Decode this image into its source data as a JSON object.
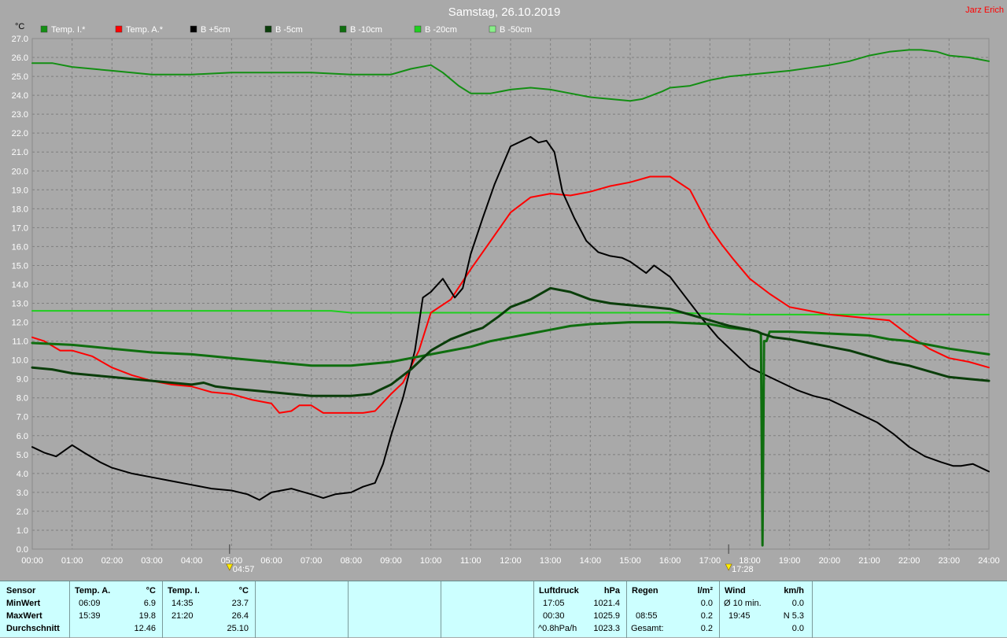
{
  "header": {
    "title": "Samstag, 26.10.2019",
    "author": "Jarz Erich"
  },
  "colors": {
    "background": "#a9a9a9",
    "grid": "#7f7f7f",
    "temp_i": "#138f13",
    "temp_a": "#ff0000",
    "b_plus5": "#000000",
    "b_minus5": "#0a3d0a",
    "b_minus10": "#0f6e0f",
    "b_minus20": "#1fcf1f",
    "b_minus50": "#88ee88",
    "footer_bg": "#ccffff"
  },
  "chart_data": {
    "type": "line",
    "title": "Samstag, 26.10.2019",
    "ylabel": "°C",
    "ylim": [
      0,
      27
    ],
    "yticks": [
      "0.0",
      "1.0",
      "2.0",
      "3.0",
      "4.0",
      "5.0",
      "6.0",
      "7.0",
      "8.0",
      "9.0",
      "10.0",
      "11.0",
      "12.0",
      "13.0",
      "14.0",
      "15.0",
      "16.0",
      "17.0",
      "18.0",
      "19.0",
      "20.0",
      "21.0",
      "22.0",
      "23.0",
      "24.0",
      "25.0",
      "26.0",
      "27.0"
    ],
    "xlim": [
      0,
      24
    ],
    "xticks": [
      "00:00",
      "01:00",
      "02:00",
      "03:00",
      "04:00",
      "05:00",
      "06:00",
      "07:00",
      "08:00",
      "09:00",
      "10:00",
      "11:00",
      "12:00",
      "13:00",
      "14:00",
      "15:00",
      "16:00",
      "17:00",
      "18:00",
      "19:00",
      "20:00",
      "21:00",
      "22:00",
      "23:00",
      "24:00"
    ],
    "grid": true,
    "legend_position": "top",
    "annotations": [
      {
        "hour": 4.95,
        "label": "04:57",
        "kind": "sunrise"
      },
      {
        "hour": 17.47,
        "label": "17:28",
        "kind": "sunset"
      }
    ],
    "series": [
      {
        "name": "Temp. I.*",
        "color_key": "temp_i",
        "width": 2,
        "x": [
          0,
          0.5,
          1,
          2,
          3,
          4,
          5,
          6,
          7,
          8,
          9,
          9.5,
          10,
          10.3,
          10.7,
          11,
          11.5,
          12,
          12.5,
          13,
          13.5,
          14,
          14.5,
          15,
          15.3,
          15.8,
          16,
          16.5,
          17,
          17.5,
          18,
          19,
          20,
          20.5,
          21,
          21.5,
          22,
          22.3,
          22.7,
          23,
          23.5,
          24
        ],
        "y": [
          25.7,
          25.7,
          25.5,
          25.3,
          25.1,
          25.1,
          25.2,
          25.2,
          25.2,
          25.1,
          25.1,
          25.4,
          25.6,
          25.2,
          24.5,
          24.1,
          24.1,
          24.3,
          24.4,
          24.3,
          24.1,
          23.9,
          23.8,
          23.7,
          23.8,
          24.2,
          24.4,
          24.5,
          24.8,
          25.0,
          25.1,
          25.3,
          25.6,
          25.8,
          26.1,
          26.3,
          26.4,
          26.4,
          26.3,
          26.1,
          26.0,
          25.8
        ]
      },
      {
        "name": "Temp. A.*",
        "color_key": "temp_a",
        "width": 2,
        "x": [
          0,
          0.3,
          0.7,
          1,
          1.5,
          2,
          2.5,
          3,
          3.5,
          4,
          4.5,
          5,
          5.5,
          6,
          6.2,
          6.5,
          6.7,
          7,
          7.3,
          7.6,
          8,
          8.3,
          8.6,
          9,
          9.3,
          9.7,
          10,
          10.5,
          11,
          11.5,
          12,
          12.5,
          13,
          13.5,
          14,
          14.5,
          15,
          15.5,
          16,
          16.5,
          17,
          17.3,
          17.6,
          18,
          18.5,
          19,
          19.5,
          20,
          20.5,
          21,
          21.5,
          22,
          22.5,
          23,
          23.5,
          24
        ],
        "y": [
          11.2,
          11.0,
          10.5,
          10.5,
          10.2,
          9.6,
          9.2,
          8.9,
          8.7,
          8.6,
          8.3,
          8.2,
          7.9,
          7.7,
          7.2,
          7.3,
          7.6,
          7.6,
          7.2,
          7.2,
          7.2,
          7.2,
          7.3,
          8.2,
          8.8,
          10.5,
          12.5,
          13.2,
          14.8,
          16.3,
          17.8,
          18.6,
          18.8,
          18.7,
          18.9,
          19.2,
          19.4,
          19.7,
          19.7,
          19.0,
          17.0,
          16.1,
          15.3,
          14.3,
          13.5,
          12.8,
          12.6,
          12.4,
          12.3,
          12.2,
          12.1,
          11.3,
          10.6,
          10.1,
          9.9,
          9.6
        ]
      },
      {
        "name": "B +5cm",
        "color_key": "b_plus5",
        "width": 2,
        "x": [
          0,
          0.3,
          0.6,
          1,
          1.3,
          1.7,
          2,
          2.5,
          3,
          3.5,
          4,
          4.5,
          5,
          5.4,
          5.7,
          6,
          6.5,
          7,
          7.3,
          7.6,
          8,
          8.3,
          8.6,
          8.8,
          9,
          9.3,
          9.6,
          9.8,
          10,
          10.3,
          10.6,
          10.8,
          11,
          11.3,
          11.6,
          12,
          12.3,
          12.5,
          12.7,
          12.9,
          13.1,
          13.3,
          13.6,
          13.9,
          14.2,
          14.5,
          14.8,
          15,
          15.2,
          15.4,
          15.6,
          16,
          16.4,
          16.8,
          17.2,
          17.6,
          18,
          18.4,
          18.8,
          19.2,
          19.6,
          20,
          20.4,
          20.8,
          21.2,
          21.6,
          22,
          22.4,
          22.8,
          23.1,
          23.3,
          23.6,
          24
        ],
        "y": [
          5.4,
          5.1,
          4.9,
          5.5,
          5.1,
          4.6,
          4.3,
          4.0,
          3.8,
          3.6,
          3.4,
          3.2,
          3.1,
          2.9,
          2.6,
          3.0,
          3.2,
          2.9,
          2.7,
          2.9,
          3.0,
          3.3,
          3.5,
          4.5,
          6.0,
          8.0,
          10.5,
          13.3,
          13.6,
          14.3,
          13.3,
          13.8,
          15.6,
          17.5,
          19.3,
          21.3,
          21.6,
          21.8,
          21.5,
          21.6,
          21.0,
          18.9,
          17.5,
          16.3,
          15.7,
          15.5,
          15.4,
          15.2,
          14.9,
          14.6,
          15.0,
          14.4,
          13.3,
          12.2,
          11.2,
          10.4,
          9.6,
          9.2,
          8.8,
          8.4,
          8.1,
          7.9,
          7.5,
          7.1,
          6.7,
          6.1,
          5.4,
          4.9,
          4.6,
          4.4,
          4.4,
          4.5,
          4.1
        ]
      },
      {
        "name": "B -5cm",
        "color_key": "b_minus5",
        "width": 3,
        "x": [
          0,
          0.5,
          1,
          1.5,
          2,
          2.5,
          3,
          3.5,
          4,
          4.3,
          4.6,
          5,
          5.5,
          6,
          6.5,
          7,
          7.5,
          8,
          8.5,
          9,
          9.5,
          10,
          10.5,
          11,
          11.3,
          11.7,
          12,
          12.5,
          13,
          13.5,
          14,
          14.5,
          15,
          15.5,
          16,
          16.5,
          17,
          17.5,
          18,
          18.2,
          18.3,
          18.6,
          19,
          19.5,
          20,
          20.5,
          21,
          21.5,
          22,
          22.5,
          23,
          23.5,
          24
        ],
        "y": [
          9.6,
          9.5,
          9.3,
          9.2,
          9.1,
          9.0,
          8.9,
          8.8,
          8.7,
          8.8,
          8.6,
          8.5,
          8.4,
          8.3,
          8.2,
          8.1,
          8.1,
          8.1,
          8.2,
          8.7,
          9.5,
          10.5,
          11.1,
          11.5,
          11.7,
          12.3,
          12.8,
          13.2,
          13.8,
          13.6,
          13.2,
          13.0,
          12.9,
          12.8,
          12.7,
          12.4,
          12.1,
          11.8,
          11.6,
          11.5,
          11.4,
          11.2,
          11.1,
          10.9,
          10.7,
          10.5,
          10.2,
          9.9,
          9.7,
          9.4,
          9.1,
          9.0,
          8.9
        ]
      },
      {
        "name": "B -10cm",
        "color_key": "b_minus10",
        "width": 3,
        "x": [
          0,
          1,
          1.5,
          2,
          2.5,
          3,
          4,
          4.5,
          5,
          5.5,
          6,
          6.5,
          7,
          7.5,
          8,
          8.5,
          9,
          9.5,
          10,
          10.5,
          11,
          11.5,
          12,
          12.5,
          13,
          13.5,
          14,
          15,
          16,
          17,
          17.5,
          18,
          18.2,
          18.28,
          18.32,
          18.36,
          18.42,
          18.5,
          19,
          20,
          21,
          21.5,
          22,
          22.5,
          23,
          24
        ],
        "y": [
          10.9,
          10.8,
          10.7,
          10.6,
          10.5,
          10.4,
          10.3,
          10.2,
          10.1,
          10.0,
          9.9,
          9.8,
          9.7,
          9.7,
          9.7,
          9.8,
          9.9,
          10.1,
          10.3,
          10.5,
          10.7,
          11.0,
          11.2,
          11.4,
          11.6,
          11.8,
          11.9,
          12.0,
          12.0,
          11.9,
          11.7,
          11.6,
          11.5,
          11.4,
          0.2,
          11.0,
          11.0,
          11.5,
          11.5,
          11.4,
          11.3,
          11.1,
          11.0,
          10.8,
          10.6,
          10.3
        ]
      },
      {
        "name": "B -20cm",
        "color_key": "b_minus20",
        "width": 2,
        "x": [
          0,
          3,
          6,
          7.5,
          8,
          10,
          12,
          13,
          14,
          16,
          18,
          20,
          22,
          24
        ],
        "y": [
          12.6,
          12.6,
          12.6,
          12.6,
          12.5,
          12.5,
          12.5,
          12.5,
          12.5,
          12.5,
          12.4,
          12.4,
          12.4,
          12.4
        ]
      },
      {
        "name": "B -50cm",
        "color_key": "b_minus50",
        "width": 1,
        "x": [],
        "y": []
      }
    ]
  },
  "footer": {
    "sensor": {
      "title": "Sensor",
      "rows": [
        "MinWert",
        "MaxWert",
        "Durchschnitt"
      ]
    },
    "temp_a": {
      "title": "Temp. A.",
      "unit": "°C",
      "rows": [
        {
          "time": "06:09",
          "value": "6.9"
        },
        {
          "time": "15:39",
          "value": "19.8"
        },
        {
          "time": "",
          "value": "12.46"
        }
      ]
    },
    "temp_i": {
      "title": "Temp. I.",
      "unit": "°C",
      "rows": [
        {
          "time": "14:35",
          "value": "23.7"
        },
        {
          "time": "21:20",
          "value": "26.4"
        },
        {
          "time": "",
          "value": "25.10"
        }
      ]
    },
    "pressure": {
      "title": "Luftdruck",
      "unit": "hPa",
      "rows": [
        {
          "time": "17:05",
          "value": "1021.4"
        },
        {
          "time": "00:30",
          "value": "1025.9"
        },
        {
          "time": "^0.8hPa/h",
          "value": "1023.3"
        }
      ]
    },
    "rain": {
      "title": "Regen",
      "unit": "l/m²",
      "rows": [
        {
          "time": "",
          "value": "0.0"
        },
        {
          "time": "08:55",
          "value": "0.2"
        },
        {
          "time": "Gesamt:",
          "value": "0.2"
        }
      ]
    },
    "wind": {
      "title": "Wind",
      "unit": "km/h",
      "rows": [
        {
          "time": "Ø 10 min.",
          "value": "0.0"
        },
        {
          "time": "19:45",
          "value": "N 5.3"
        },
        {
          "time": "",
          "value": "0.0"
        }
      ]
    }
  }
}
